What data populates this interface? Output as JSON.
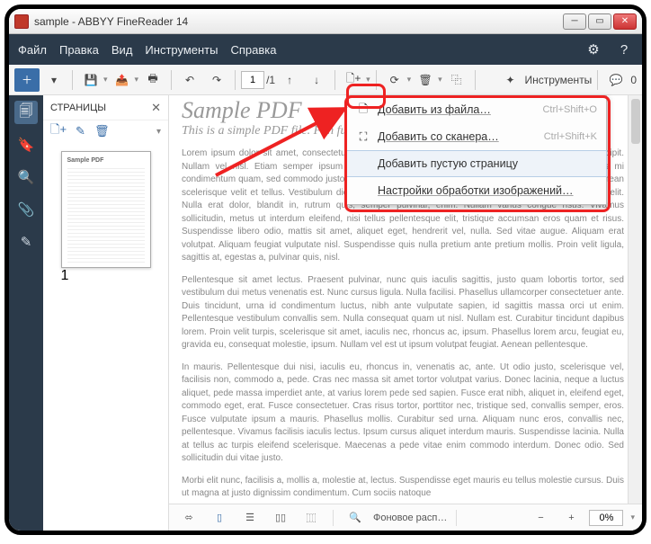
{
  "title": "sample - ABBYY FineReader 14",
  "menu": {
    "file": "Файл",
    "edit": "Правка",
    "view": "Вид",
    "tools": "Инструменты",
    "help": "Справка"
  },
  "toolbar": {
    "page_current": "1",
    "page_total": "/1",
    "tools_label": "Инструменты",
    "comments_count": "0"
  },
  "sidebar": {
    "title": "СТРАНИЦЫ",
    "thumb_num": "1"
  },
  "doc": {
    "h1": "Sample PDF",
    "sub": "This is a simple PDF file. Fun fun fun.",
    "p1": "Lorem ipsum dolor sit amet, consectetuer adipiscing elit. Phasellus facilisis odio sed mi. Curabitur suscipit. Nullam vel nisl. Etiam semper ipsum ut lectus. Proin aliquam, erat eget pharetra commodo, eros mi condimentum quam, sed commodo justo quam ut velit. Integer a erat. Cras laoreet ligula cursus enim. Aenean scelerisque velit et tellus. Vestibulum dictum aliquet sem. Nulla facilisi. Vestibulum accumsan ante vitae elit. Nulla erat dolor, blandit in, rutrum quis, semper pulvinar, enim. Nullam varius congue risus. Vivamus sollicitudin, metus ut interdum eleifend, nisi tellus pellentesque elit, tristique accumsan eros quam et risus. Suspendisse libero odio, mattis sit amet, aliquet eget, hendrerit vel, nulla. Sed vitae augue. Aliquam erat volutpat. Aliquam feugiat vulputate nisl. Suspendisse quis nulla pretium ante pretium mollis. Proin velit ligula, sagittis at, egestas a, pulvinar quis, nisl.",
    "p2": "Pellentesque sit amet lectus. Praesent pulvinar, nunc quis iaculis sagittis, justo quam lobortis tortor, sed vestibulum dui metus venenatis est. Nunc cursus ligula. Nulla facilisi. Phasellus ullamcorper consectetuer ante. Duis tincidunt, urna id condimentum luctus, nibh ante vulputate sapien, id sagittis massa orci ut enim. Pellentesque vestibulum convallis sem. Nulla consequat quam ut nisl. Nullam est. Curabitur tincidunt dapibus lorem. Proin velit turpis, scelerisque sit amet, iaculis nec, rhoncus ac, ipsum. Phasellus lorem arcu, feugiat eu, gravida eu, consequat molestie, ipsum. Nullam vel est ut ipsum volutpat feugiat. Aenean pellentesque.",
    "p3": "In mauris. Pellentesque dui nisi, iaculis eu, rhoncus in, venenatis ac, ante. Ut odio justo, scelerisque vel, facilisis non, commodo a, pede. Cras nec massa sit amet tortor volutpat varius. Donec lacinia, neque a luctus aliquet, pede massa imperdiet ante, at varius lorem pede sed sapien. Fusce erat nibh, aliquet in, eleifend eget, commodo eget, erat. Fusce consectetuer. Cras risus tortor, porttitor nec, tristique sed, convallis semper, eros. Fusce vulputate ipsum a mauris. Phasellus mollis. Curabitur sed urna. Aliquam nunc eros, convallis nec, pellentesque. Vivamus facilisis iaculis lectus. Ipsum cursus aliquet interdum mauris. Suspendisse lacinia. Nulla at tellus ac turpis eleifend scelerisque. Maecenas a pede vitae enim commodo interdum. Donec odio. Sed sollicitudin dui vitae justo.",
    "p4": "Morbi elit nunc, facilisis a, mollis a, molestie at, lectus. Suspendisse eget mauris eu tellus molestie cursus. Duis ut magna at justo dignissim condimentum. Cum sociis natoque"
  },
  "dropdown": {
    "add_from_file": "Добавить из файла…",
    "sc1": "Ctrl+Shift+O",
    "add_from_scanner": "Добавить со сканера…",
    "sc2": "Ctrl+Shift+K",
    "add_blank": "Добавить пустую страницу",
    "img_settings": "Настройки обработки изображений…"
  },
  "bottombar": {
    "bg_recog": "Фоновое расп…",
    "zoom": "0%"
  }
}
